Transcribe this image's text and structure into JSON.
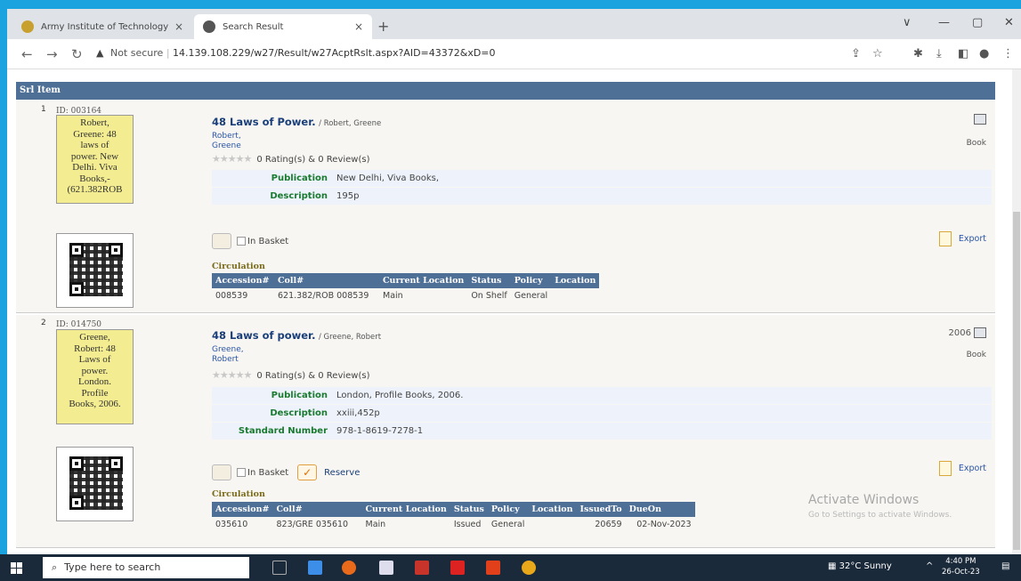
{
  "browser": {
    "tabs": [
      {
        "label": "Army Institute of Technology",
        "close": "×"
      },
      {
        "label": "Search Result",
        "close": "×"
      }
    ],
    "new_tab": "+",
    "url_warning": "Not secure",
    "url": "14.139.108.229/w27/Result/w27AcptRslt.aspx?AID=43372&xD=0",
    "window_controls": [
      "∨",
      "—",
      "▢",
      "✕"
    ]
  },
  "results": {
    "header": "Srl  Item",
    "records": [
      {
        "srl": "1",
        "id": "ID:  003164",
        "card_text": [
          "Robert,",
          "Greene: 48",
          "laws of",
          "power.  New",
          "Delhi.  Viva",
          "Books,-",
          "(621.382ROB"
        ],
        "title": "48 Laws of Power.",
        "author_suffix": " / Robert, Greene",
        "authors": [
          "Robert,",
          "Greene"
        ],
        "year": "",
        "format": "Book",
        "rating": "0 Rating(s) & 0 Review(s)",
        "details": [
          {
            "k": "Publication",
            "v": "New Delhi, Viva Books,"
          },
          {
            "k": "Description",
            "v": "195p"
          }
        ],
        "basket": "In Basket",
        "reserve": "",
        "export": "Export",
        "circulation": "Circulation",
        "columns": [
          "Accession#",
          "Coll#",
          "Current Location",
          "Status",
          "Policy",
          "Location"
        ],
        "rows": [
          [
            "008539",
            "621.382/ROB 008539",
            "Main",
            "On Shelf",
            "General",
            ""
          ]
        ]
      },
      {
        "srl": "2",
        "id": "ID:  014750",
        "card_text": [
          "Greene,",
          "Robert: 48",
          "Laws of",
          "power.",
          "London.",
          "Profile",
          "Books, 2006."
        ],
        "title": "48 Laws of power.",
        "author_suffix": " / Greene, Robert",
        "authors": [
          "Greene,",
          "Robert"
        ],
        "year": "2006",
        "format": "Book",
        "rating": "0 Rating(s) & 0 Review(s)",
        "details": [
          {
            "k": "Publication",
            "v": "London, Profile Books, 2006."
          },
          {
            "k": "Description",
            "v": "xxiii,452p"
          },
          {
            "k": "Standard Number",
            "v": "978-1-8619-7278-1"
          }
        ],
        "basket": "In Basket",
        "reserve": "Reserve",
        "export": "Export",
        "circulation": "Circulation",
        "columns": [
          "Accession#",
          "Coll#",
          "Current Location",
          "Status",
          "Policy",
          "Location",
          "IssuedTo",
          "DueOn"
        ],
        "rows": [
          [
            "035610",
            "823/GRE 035610",
            "Main",
            "Issued",
            "General",
            "",
            "20659",
            "02-Nov-2023"
          ]
        ]
      }
    ]
  },
  "watermark": {
    "title": "Activate Windows",
    "subtitle": "Go to Settings to activate Windows."
  },
  "taskbar": {
    "search_placeholder": "Type here to search",
    "weather": "32°C  Sunny",
    "time": "4:40 PM",
    "date": "26-Oct-23"
  },
  "colors": {
    "accent": "#4e6f96",
    "card": "#f3ec90",
    "desktop": "#1aa3de"
  }
}
